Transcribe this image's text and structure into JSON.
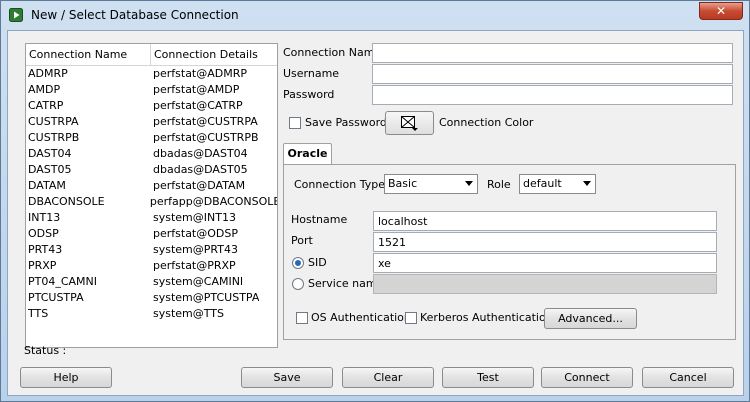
{
  "window": {
    "title": "New / Select Database Connection",
    "close_label": "✕"
  },
  "connections": {
    "headers": [
      "Connection Name",
      "Connection Details"
    ],
    "rows": [
      [
        "ADMRP",
        "perfstat@ADMRP"
      ],
      [
        "AMDP",
        "perfstat@AMDP"
      ],
      [
        "CATRP",
        "perfstat@CATRP"
      ],
      [
        "CUSTRPA",
        "perfstat@CUSTRPA"
      ],
      [
        "CUSTRPB",
        "perfstat@CUSTRPB"
      ],
      [
        "DAST04",
        "dbadas@DAST04"
      ],
      [
        "DAST05",
        "dbadas@DAST05"
      ],
      [
        "DATAM",
        "perfstat@DATAM"
      ],
      [
        "DBACONSOLE",
        "perfapp@DBACONSOLE"
      ],
      [
        "INT13",
        "system@INT13"
      ],
      [
        "ODSP",
        "perfstat@ODSP"
      ],
      [
        "PRT43",
        "system@PRT43"
      ],
      [
        "PRXP",
        "perfstat@PRXP"
      ],
      [
        "PT04_CAMNI",
        "system@CAMINI"
      ],
      [
        "PTCUSTPA",
        "system@PTCUSTPA"
      ],
      [
        "TTS",
        "system@TTS"
      ]
    ]
  },
  "form": {
    "connection_name_label": "Connection Name",
    "connection_name_value": "",
    "username_label": "Username",
    "username_value": "",
    "password_label": "Password",
    "password_value": "",
    "save_password_label": "Save Password",
    "connection_color_label": "Connection Color"
  },
  "oracle": {
    "tab_label": "Oracle",
    "connection_type_label": "Connection Type",
    "connection_type_value": "Basic",
    "role_label": "Role",
    "role_value": "default",
    "hostname_label": "Hostname",
    "hostname_value": "localhost",
    "port_label": "Port",
    "port_value": "1521",
    "sid_label": "SID",
    "sid_value": "xe",
    "service_name_label": "Service name",
    "service_name_value": "",
    "os_auth_label": "OS Authentication",
    "kerberos_auth_label": "Kerberos Authentication",
    "advanced_label": "Advanced..."
  },
  "status": {
    "label": "Status :"
  },
  "buttons": {
    "help": "Help",
    "save": "Save",
    "clear": "Clear",
    "test": "Test",
    "connect": "Connect",
    "cancel": "Cancel"
  },
  "colors": {
    "title_gradient": "#b9d1ea",
    "close_red": "#c94a32",
    "radio_dot": "#2a66b8"
  }
}
